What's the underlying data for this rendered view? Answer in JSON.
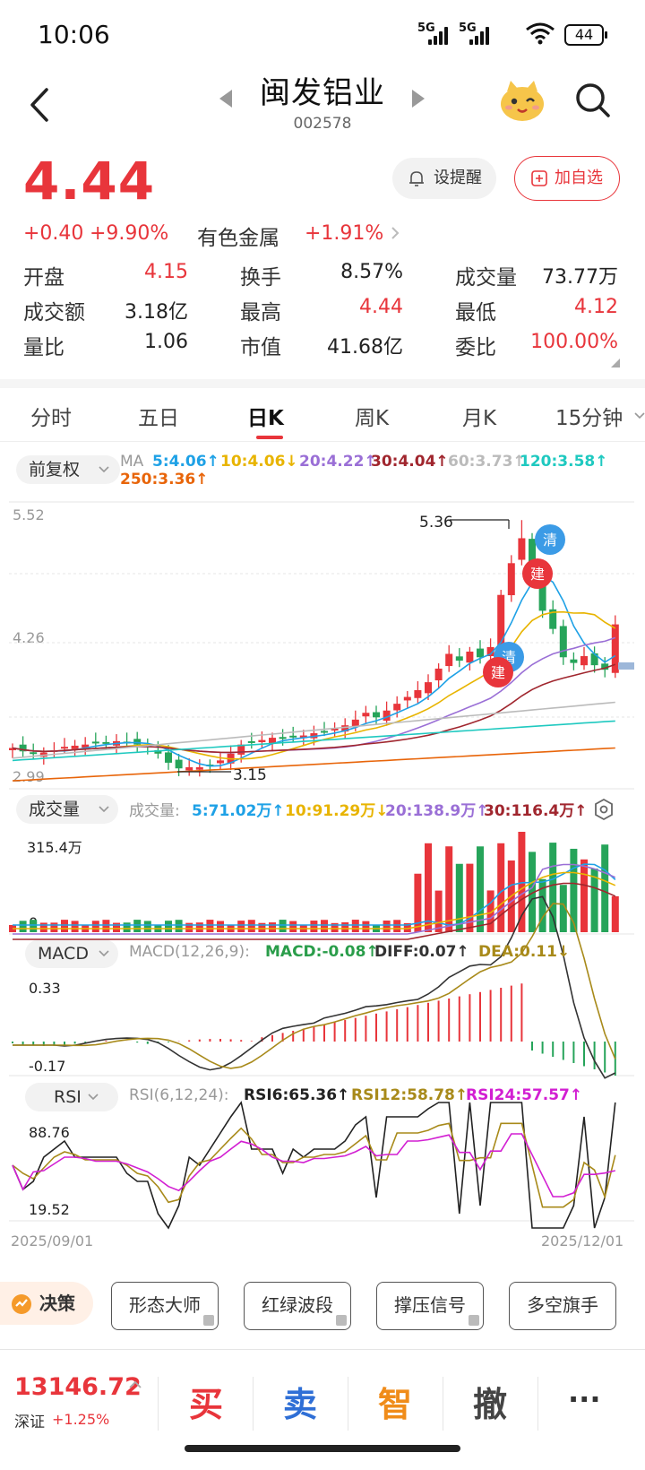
{
  "status": {
    "time": "10:06",
    "net1": "5G",
    "net2": "5G",
    "battery": "44"
  },
  "header": {
    "title": "闽发铝业",
    "code": "002578"
  },
  "quote": {
    "price": "4.44",
    "change": "+0.40",
    "change_pct": "+9.90%",
    "sector": "有色金属",
    "sector_pct": "+1.91%",
    "alert_label": "设提醒",
    "watch_label": "加自选",
    "rows": [
      [
        {
          "label": "开盘",
          "value": "4.15",
          "color": "#e8353b"
        },
        {
          "label": "换手",
          "value": "8.57%",
          "color": "#222"
        },
        {
          "label": "成交量",
          "value": "73.77万",
          "color": "#222"
        }
      ],
      [
        {
          "label": "成交额",
          "value": "3.18亿",
          "color": "#222"
        },
        {
          "label": "最高",
          "value": "4.44",
          "color": "#e8353b"
        },
        {
          "label": "最低",
          "value": "4.12",
          "color": "#e8353b"
        }
      ],
      [
        {
          "label": "量比",
          "value": "1.06",
          "color": "#222"
        },
        {
          "label": "市值",
          "value": "41.68亿",
          "color": "#222"
        },
        {
          "label": "委比",
          "value": "100.00%",
          "color": "#e8353b"
        }
      ]
    ]
  },
  "tabs": [
    "分时",
    "五日",
    "日K",
    "周K",
    "月K",
    "15分钟"
  ],
  "active_tab": "日K",
  "kline": {
    "adjust_label": "前复权",
    "ma_title": "MA",
    "ma": [
      {
        "label": "5:4.06↑",
        "color": "#1ea1e6"
      },
      {
        "label": "10:4.06↓",
        "color": "#e8b400"
      },
      {
        "label": "20:4.22↑",
        "color": "#9a6fd6"
      },
      {
        "label": "30:4.04↑",
        "color": "#a0262e"
      },
      {
        "label": "60:3.73↑",
        "color": "#bbbbbb"
      },
      {
        "label": "120:3.58↑",
        "color": "#1fc9c0"
      },
      {
        "label": "250:3.36↑",
        "color": "#e8650a"
      }
    ],
    "axis": {
      "top": "5.52",
      "mid": "4.26",
      "bottom": "2.99"
    },
    "high_label": "5.36",
    "low_label": "3.15",
    "badge_clear": "清",
    "badge_build": "建"
  },
  "volume": {
    "label": "成交量",
    "title": "成交量:",
    "items": [
      {
        "label": "5:71.02万↑",
        "color": "#1ea1e6"
      },
      {
        "label": "10:91.29万↓",
        "color": "#e8b400"
      },
      {
        "label": "20:138.9万↑",
        "color": "#9a6fd6"
      },
      {
        "label": "30:116.4万↑",
        "color": "#a0262e"
      }
    ],
    "axis_top": "315.4万",
    "axis_zero": "0"
  },
  "macd": {
    "label": "MACD",
    "params": "MACD(12,26,9):",
    "items": [
      {
        "label": "MACD:-0.08↑",
        "color": "#2a9d4a"
      },
      {
        "label": "DIFF:0.07↑",
        "color": "#333333"
      },
      {
        "label": "DEA:0.11↓",
        "color": "#a88a1a"
      }
    ],
    "axis_top": "0.33",
    "axis_bottom": "-0.17"
  },
  "rsi": {
    "label": "RSI",
    "params": "RSI(6,12,24):",
    "items": [
      {
        "label": "RSI6:65.36↑",
        "color": "#222222"
      },
      {
        "label": "RSI12:58.78↑",
        "color": "#a88a1a"
      },
      {
        "label": "RSI24:57.57↑",
        "color": "#d21fd2"
      }
    ],
    "axis_top": "88.76",
    "axis_bottom": "19.52",
    "date_start": "2025/09/01",
    "date_end": "2025/12/01"
  },
  "tools": {
    "decision": "决策",
    "buttons": [
      "形态大师",
      "红绿波段",
      "撑压信号",
      "多空旗手"
    ]
  },
  "bottom": {
    "index_value": "13146.72",
    "index_name": "深证",
    "index_change": "+1.25%",
    "buy": "买",
    "sell": "卖",
    "smart": "智",
    "cancel": "撤",
    "more": "···"
  },
  "colors": {
    "up": "#e8353b",
    "down": "#26a45a",
    "accent": "#e8353b"
  }
}
